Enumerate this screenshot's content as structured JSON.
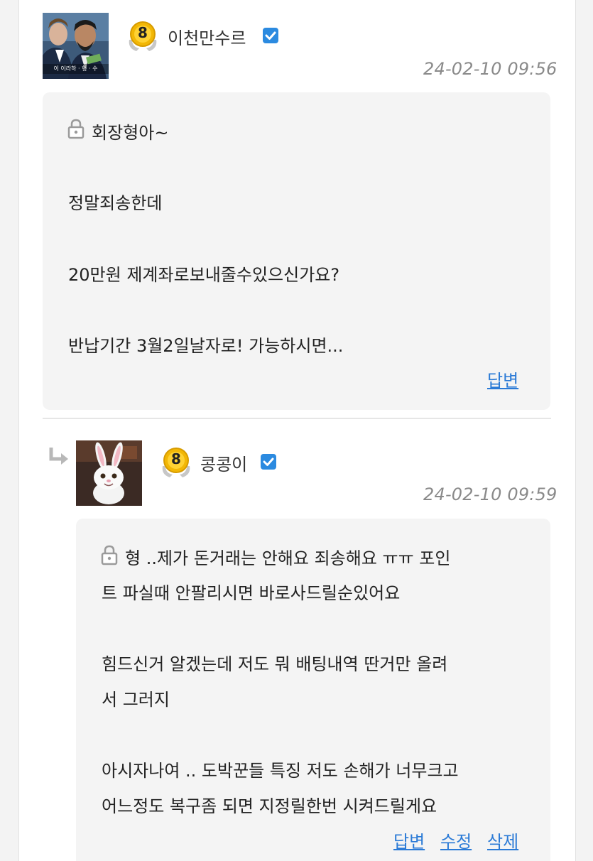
{
  "comments": [
    {
      "username": "이천만수르",
      "avatar_caption": "이 이라하 · 형 · 수",
      "level": "8",
      "timestamp": "24-02-10 09:56",
      "lines": [
        "회장형아~",
        "정말죄송한데",
        "20만원 제계좌로보내줄수있으신가요?",
        "반납기간 3월2일날자로! 가능하시면..."
      ],
      "actions": {
        "reply": "답변"
      }
    },
    {
      "username": "콩콩이",
      "level": "8",
      "timestamp": "24-02-10 09:59",
      "lines": [
        "형 ..제가 돈거래는 안해요 죄송해요 ㅠㅠ 포인",
        "트 파실때 안팔리시면 바로사드릴순있어요",
        "힘드신거 알겠는데 저도 뭐 배팅내역 딴거만 올려",
        "서 그러지",
        "아시자나여 .. 도박꾼들 특징 저도 손해가 너무크고",
        "어느정도 복구좀 되면 지정릴한번 시켜드릴게요"
      ],
      "actions": {
        "reply": "답변",
        "edit": "수정",
        "delete": "삭제"
      }
    }
  ],
  "colors": {
    "link": "#2a7ad6",
    "verified": "#2b8ae0",
    "badge_gold": "#f2b705",
    "bubble": "#f4f4f4",
    "timestamp": "#8a8a8a"
  },
  "icons": {
    "lock": "lock-icon",
    "verified": "verified-check-icon",
    "reply": "reply-arrow-icon",
    "level": "level-badge-icon"
  }
}
